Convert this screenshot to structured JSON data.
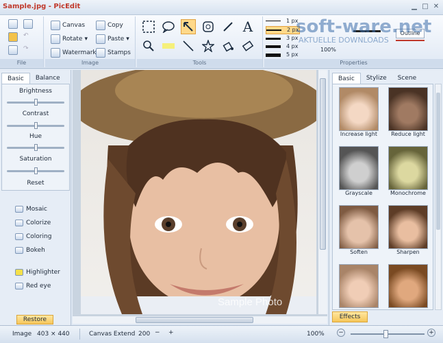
{
  "window": {
    "title": "Sample.jpg - PicEdit"
  },
  "ribbon": {
    "file_label": "File",
    "image_label": "Image",
    "tools_label": "Tools",
    "properties_label": "Properties",
    "canvas": "Canvas",
    "rotate": "Rotate",
    "watermark": "Watermark",
    "copy": "Copy",
    "paste": "Paste",
    "stamps": "Stamps",
    "widths": [
      "1 px",
      "2 px",
      "3 px",
      "4 px",
      "5 px"
    ],
    "zoom": "100%",
    "outline": "Outline"
  },
  "watermark": {
    "line1": "soft-ware.net",
    "line2": "AKTUELLE DOWNLOADS"
  },
  "left": {
    "tabs": [
      "Basic",
      "Balance"
    ],
    "sliders": [
      {
        "label": "Brightness",
        "value": 0.5
      },
      {
        "label": "Contrast",
        "value": 0.5
      },
      {
        "label": "Hue",
        "value": 0.5
      },
      {
        "label": "Saturation",
        "value": 0.5
      }
    ],
    "reset": "Reset",
    "effects": [
      "Mosaic",
      "Colorize",
      "Coloring",
      "Bokeh"
    ],
    "tools": [
      "Highlighter",
      "Red eye"
    ],
    "restore": "Restore"
  },
  "canvas": {
    "sample_label": "Sample Photo"
  },
  "right": {
    "tabs": [
      "Basic",
      "Stylize",
      "Scene"
    ],
    "effects": [
      "Increase light",
      "Reduce light",
      "Grayscale",
      "Monochrome",
      "Soften",
      "Sharpen"
    ],
    "effects_button": "Effects"
  },
  "status": {
    "image_label": "Image",
    "image_size": "403 × 440",
    "extend_label": "Canvas Extend",
    "extend_value": "200",
    "zoom": "100%",
    "minus": "−",
    "plus": "+"
  }
}
